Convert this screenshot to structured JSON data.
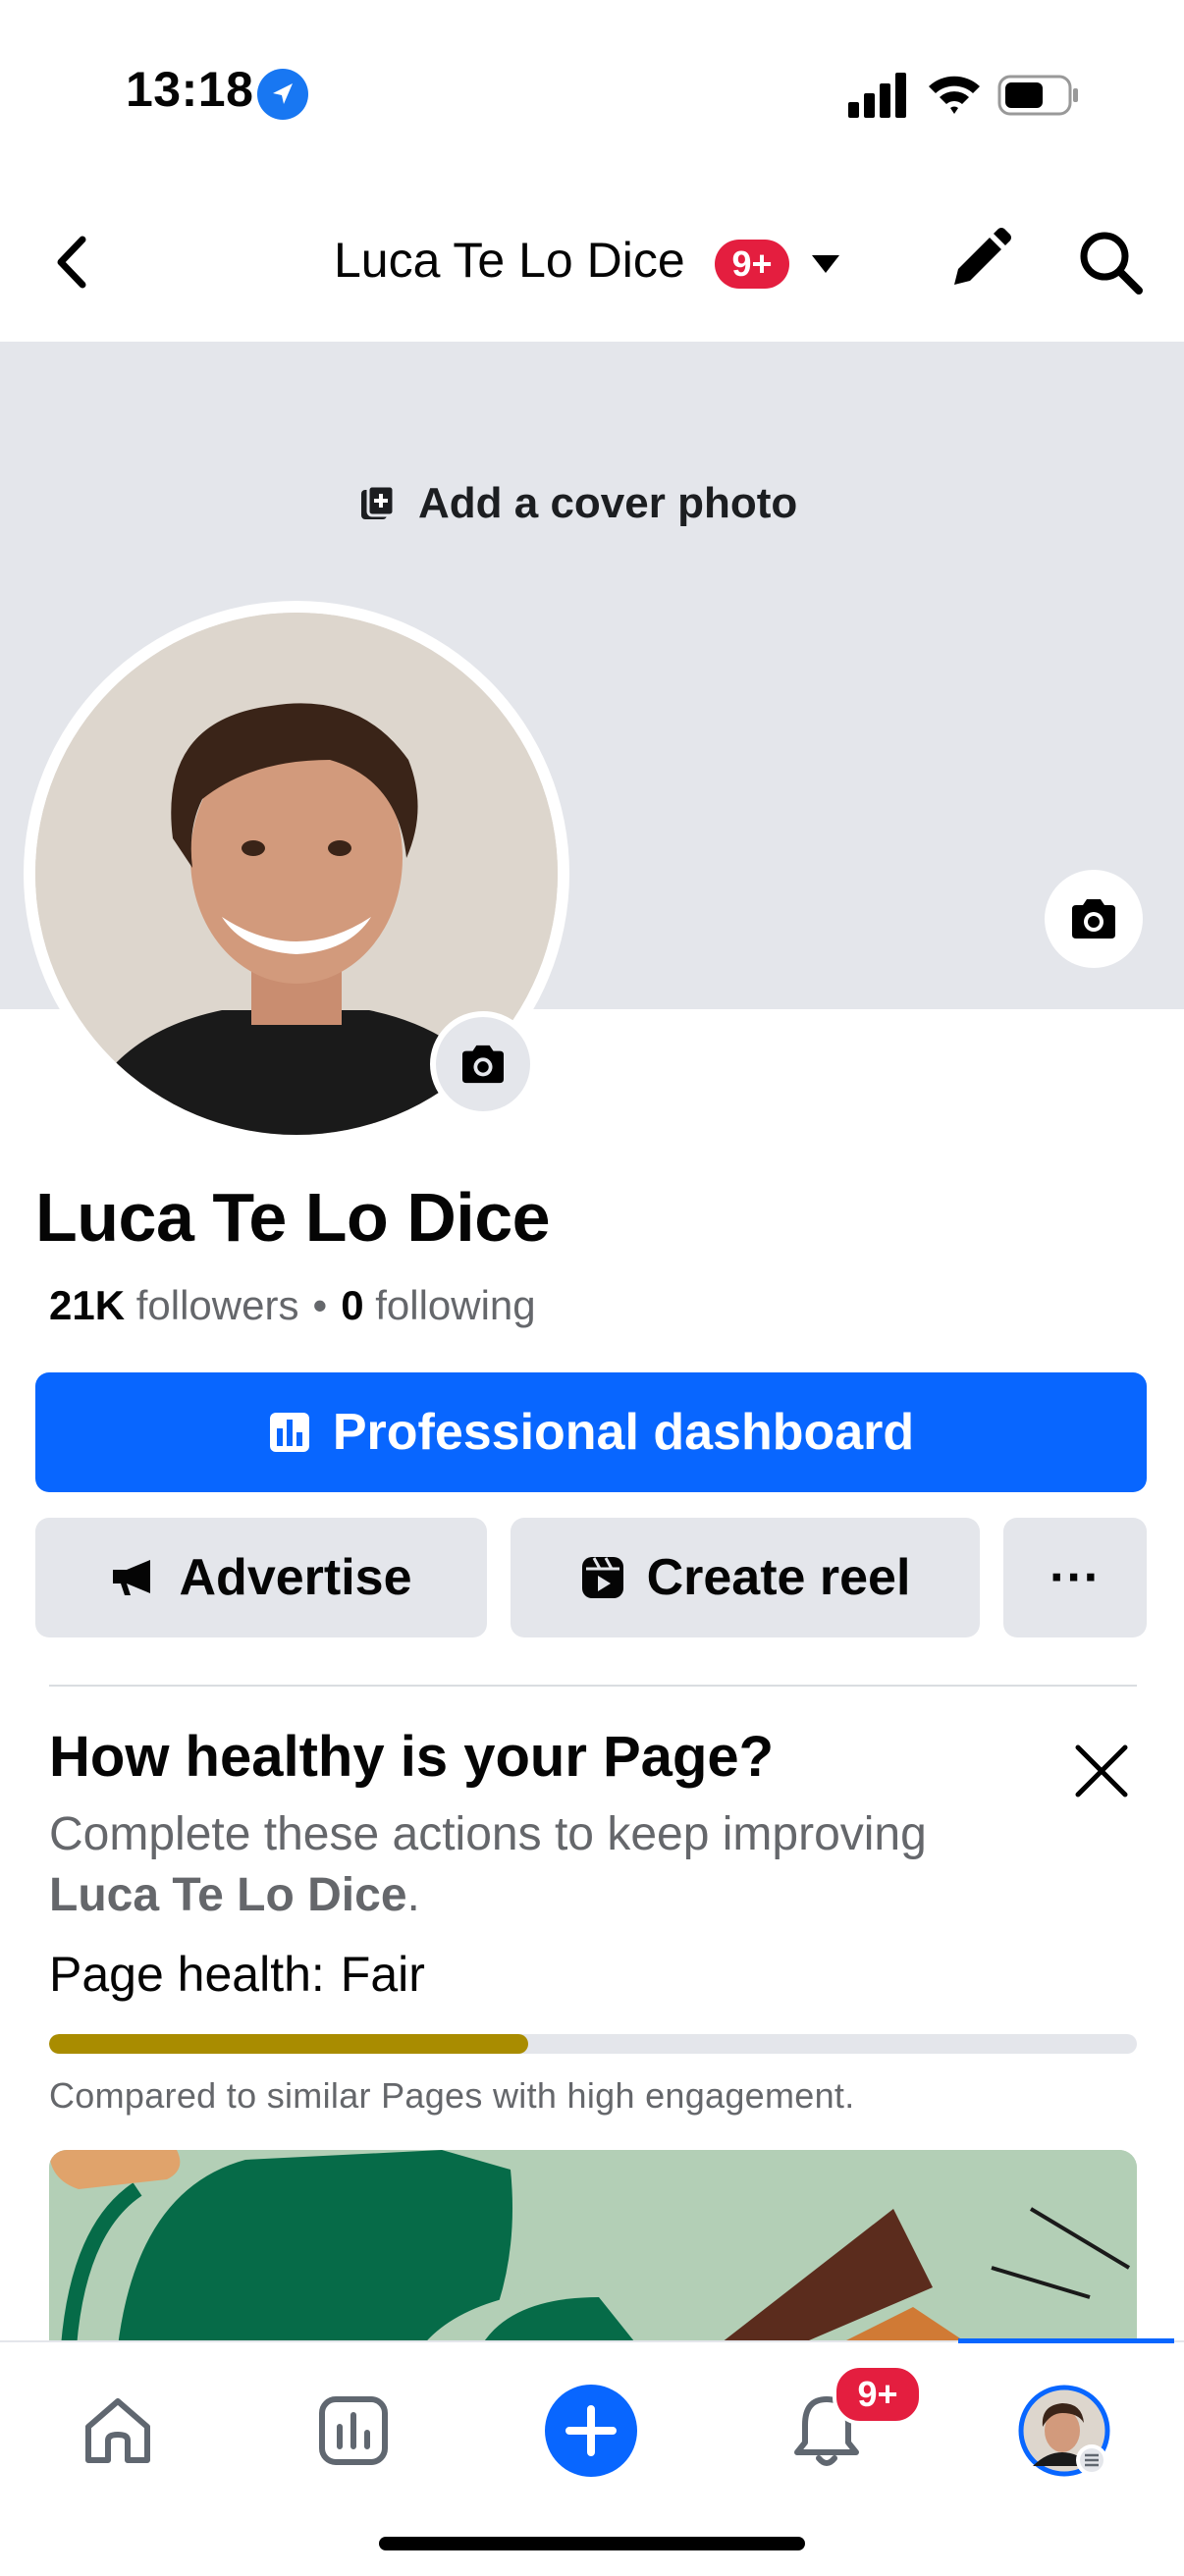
{
  "status_bar": {
    "time": "13:18",
    "icons": [
      "location-arrow-icon",
      "cellular-signal-icon",
      "wifi-icon",
      "battery-icon"
    ]
  },
  "header": {
    "page_name": "Luca Te Lo Dice",
    "notification_badge": "9+",
    "icons": [
      "back-chevron-icon",
      "caret-down-icon",
      "pencil-icon",
      "search-icon"
    ]
  },
  "cover": {
    "add_cover_label": "Add a cover photo"
  },
  "profile": {
    "name": "Luca Te Lo Dice",
    "followers_count": "21K",
    "followers_label": "followers",
    "separator": "•",
    "following_count": "0",
    "following_label": "following"
  },
  "actions": {
    "professional_dashboard": "Professional dashboard",
    "advertise": "Advertise",
    "create_reel": "Create reel",
    "more": "···"
  },
  "health_card": {
    "title": "How healthy is your Page?",
    "subtitle": "Complete these actions to keep improving",
    "subtitle_page": "Luca Te Lo Dice",
    "subtitle_end": ".",
    "health_label": "Page health:",
    "health_value": "Fair",
    "progress_fraction": 0.44,
    "progress_color": "#a98c00",
    "compared_text": "Compared to similar Pages with high engagement."
  },
  "bottom_nav": {
    "items": [
      "home-icon",
      "insights-icon",
      "create-plus-icon",
      "notifications-bell-icon",
      "profile-avatar"
    ],
    "notification_badge": "9+",
    "accent": "#0866ff"
  }
}
